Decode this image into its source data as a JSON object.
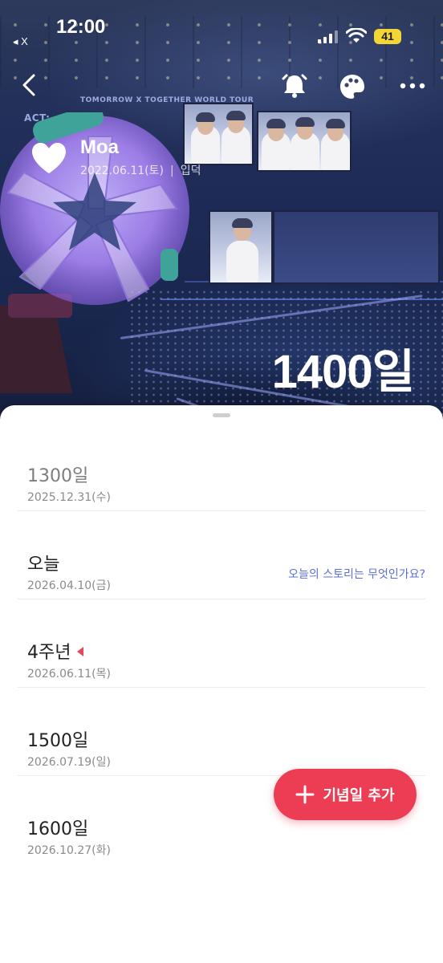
{
  "status_bar": {
    "time": "12:00",
    "back_app": "◂ X",
    "battery": "41",
    "icons": [
      "signal-icon",
      "wifi-icon"
    ]
  },
  "nav": {
    "icons": [
      "back-icon",
      "alarm-icon",
      "palette-icon",
      "more-icon"
    ]
  },
  "profile": {
    "name": "Moa",
    "date": "2022.06.11(토)",
    "separator": "|",
    "tag": "입덕",
    "day_count": "1400일",
    "icon": "heart-icon"
  },
  "anniversaries": [
    {
      "title": "1300일",
      "date": "2025.12.31(수)",
      "past": true
    },
    {
      "title": "오늘",
      "date": "2026.04.10(금)",
      "story": "오늘의 스토리는 무엇인가요?"
    },
    {
      "title": "4주년",
      "date": "2026.06.11(목)",
      "highlight": true
    },
    {
      "title": "1500일",
      "date": "2026.07.19(일)"
    },
    {
      "title": "1600일",
      "date": "2026.10.27(화)"
    }
  ],
  "fab": {
    "label": "기념일 추가",
    "icon": "plus-icon"
  },
  "colors": {
    "accent": "#ec3d55",
    "link": "#5b6fd6",
    "marker": "#e04a5a"
  }
}
